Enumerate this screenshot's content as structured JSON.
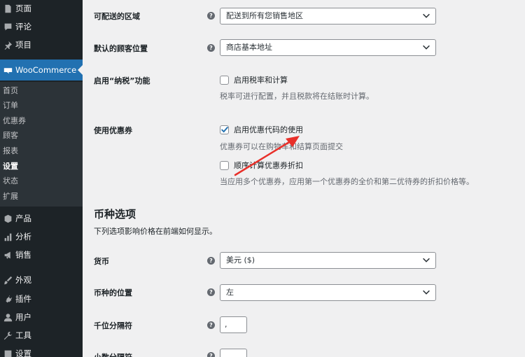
{
  "sidebar": {
    "items_top": [
      {
        "label": "页面",
        "icon": "page-icon"
      },
      {
        "label": "评论",
        "icon": "comment-icon"
      },
      {
        "label": "项目",
        "icon": "pin-icon"
      }
    ],
    "woocommerce": {
      "label": "WooCommerce",
      "icon": "woocommerce-icon"
    },
    "submenu": [
      {
        "label": "首页"
      },
      {
        "label": "订单"
      },
      {
        "label": "优惠券"
      },
      {
        "label": "顾客"
      },
      {
        "label": "报表"
      },
      {
        "label": "设置"
      },
      {
        "label": "状态"
      },
      {
        "label": "扩展"
      }
    ],
    "items_bottom": [
      {
        "label": "产品",
        "icon": "box-icon"
      },
      {
        "label": "分析",
        "icon": "chart-icon"
      },
      {
        "label": "销售",
        "icon": "megaphone-icon"
      },
      {
        "label": "外观",
        "icon": "brush-icon"
      },
      {
        "label": "插件",
        "icon": "plug-icon"
      },
      {
        "label": "用户",
        "icon": "user-icon"
      },
      {
        "label": "工具",
        "icon": "wrench-icon"
      },
      {
        "label": "设置",
        "icon": "settings-icon"
      }
    ]
  },
  "form": {
    "ship_region": {
      "label": "可配送的区域",
      "value": "配送到所有您销售地区"
    },
    "default_location": {
      "label": "默认的顾客位置",
      "value": "商店基本地址"
    },
    "tax": {
      "label": "启用“纳税”功能",
      "checkbox": "启用税率和计算",
      "desc": "税率可进行配置，并且税款将在结账时计算。"
    },
    "coupons": {
      "label": "使用优惠券",
      "checkbox1": "启用优惠代码的使用",
      "desc1": "优惠券可以在购物车和结算页面提交",
      "checkbox2": "顺序计算优惠券折扣",
      "desc2": "当应用多个优惠券，应用第一个优惠券的全价和第二优待券的折扣价格等。"
    },
    "currency_section": {
      "title": "币种选项",
      "desc": "下列选项影响价格在前端如何显示。"
    },
    "currency": {
      "label": "货币",
      "value": "美元 ($)"
    },
    "currency_position": {
      "label": "币种的位置",
      "value": "左"
    },
    "thousand_sep": {
      "label": "千位分隔符",
      "value": ","
    },
    "decimal_sep": {
      "label": "小数分隔符"
    }
  },
  "colors": {
    "accent": "#2271b1",
    "annotation_arrow": "#e8302a"
  }
}
